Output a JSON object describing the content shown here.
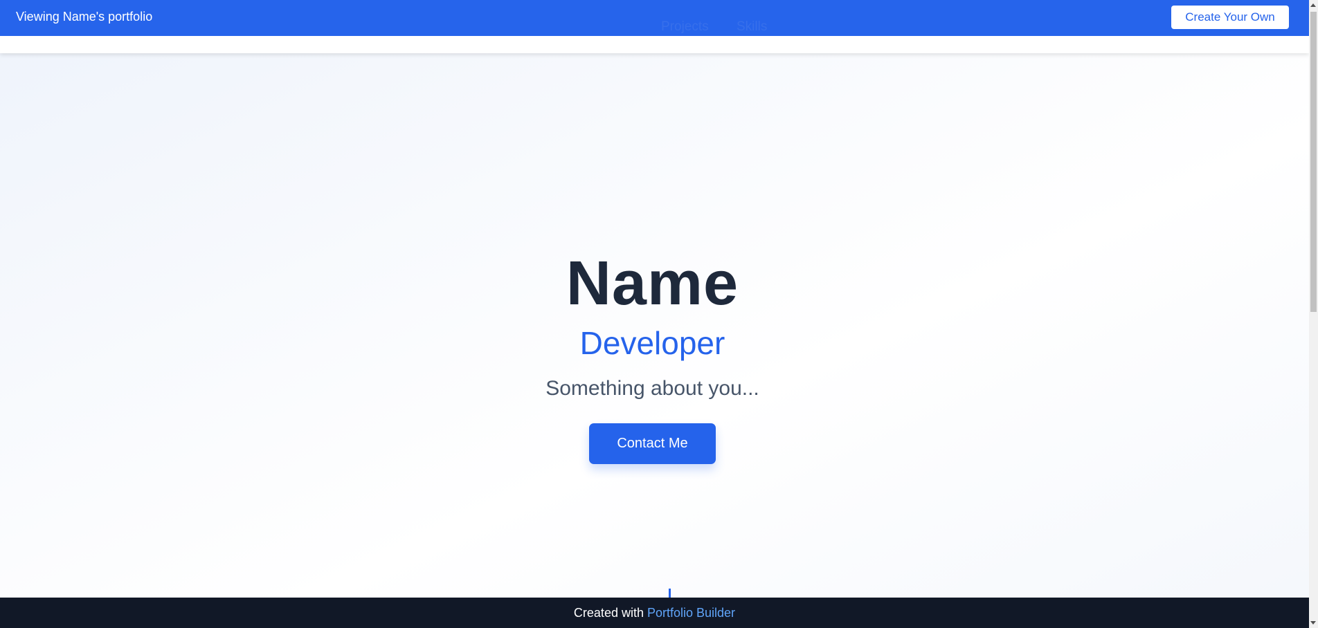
{
  "banner": {
    "viewing_text": "Viewing Name's portfolio",
    "create_button": "Create Your Own",
    "background_color": "#2563eb"
  },
  "nav": {
    "links": [
      "Projects",
      "Skills"
    ]
  },
  "hero": {
    "name": "Name",
    "role": "Developer",
    "about": "Something about you...",
    "contact_button": "Contact Me",
    "accent_color": "#2563eb"
  },
  "footer": {
    "prefix": "Created with",
    "link_text": "Portfolio Builder",
    "background_color": "#111827"
  }
}
